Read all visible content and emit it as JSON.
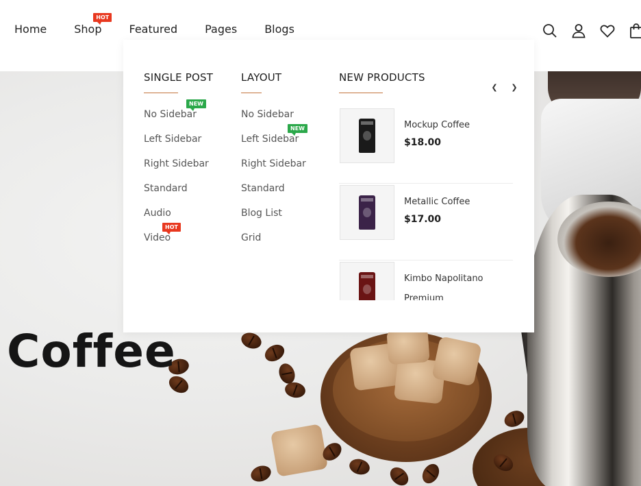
{
  "nav": {
    "items": [
      {
        "label": "Home"
      },
      {
        "label": "Shop",
        "badge": "HOT"
      },
      {
        "label": "Featured"
      },
      {
        "label": "Pages"
      },
      {
        "label": "Blogs"
      }
    ]
  },
  "header_icons": [
    "search-icon",
    "user-icon",
    "heart-icon",
    "shopping-bag-icon"
  ],
  "mega_menu": {
    "single_post": {
      "title": "SINGLE POST",
      "links": [
        {
          "label": "No Sidebar",
          "badge": "NEW"
        },
        {
          "label": "Left Sidebar"
        },
        {
          "label": "Right Sidebar"
        },
        {
          "label": "Standard"
        },
        {
          "label": "Audio"
        },
        {
          "label": "Video",
          "badge": "HOT"
        }
      ]
    },
    "layout": {
      "title": "LAYOUT",
      "links": [
        {
          "label": "No Sidebar"
        },
        {
          "label": "Left Sidebar",
          "badge": "NEW"
        },
        {
          "label": "Right Sidebar"
        },
        {
          "label": "Standard"
        },
        {
          "label": "Blog List"
        },
        {
          "label": "Grid"
        }
      ]
    },
    "new_products": {
      "title": "NEW PRODUCTS",
      "prev_icon": "chevron-left-icon",
      "next_icon": "chevron-right-icon",
      "items": [
        {
          "name": "Mockup Coffee",
          "price": "$18.00",
          "bag_color": "#1a1a1a"
        },
        {
          "name": "Metallic Coffee",
          "price": "$17.00",
          "bag_color": "#3b2348"
        },
        {
          "name": "Kimbo Napolitano Premium",
          "price": "",
          "bag_color": "#6a1414"
        }
      ]
    }
  },
  "hero": {
    "title": "Coffee"
  },
  "colors": {
    "accent_rule": "#c4753f",
    "badge_hot": "#e8381f",
    "badge_new": "#2ba84a"
  }
}
